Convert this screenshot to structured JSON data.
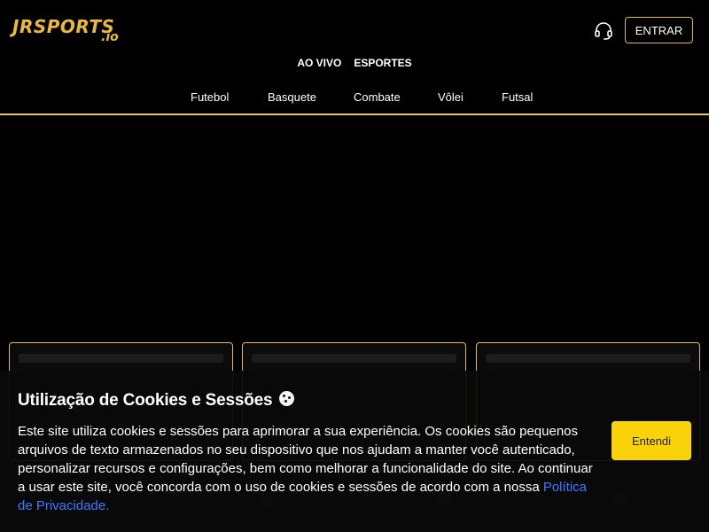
{
  "brand": {
    "logo_main": "JRSPORTS",
    "logo_sub": ".io",
    "color": "#e8b93a"
  },
  "header": {
    "support_icon": "headset-icon",
    "login_label": "ENTRAR"
  },
  "top_nav": [
    {
      "label": "AO VIVO"
    },
    {
      "label": "ESPORTES"
    }
  ],
  "sport_nav": [
    {
      "label": "Futebol"
    },
    {
      "label": "Basquete"
    },
    {
      "label": "Combate"
    },
    {
      "label": "Vôlei"
    },
    {
      "label": "Futsal"
    }
  ],
  "cookie": {
    "title": "Utilização de Cookies e Sessões",
    "title_icon": "cookie-icon",
    "text": "Este site utiliza cookies e sessões para aprimorar a sua experiência. Os cookies são pequenos arquivos de texto armazenados no seu dispositivo que nos ajudam a manter você autenticado, personalizar recursos e configurações, bem como melhorar a funcionalidade do site. Ao continuar a usar este site, você concorda com o uso de cookies e sessões de acordo com a nossa",
    "link_label": "Política de Privacidade.",
    "accept_label": "Entendi"
  },
  "colors": {
    "accent": "#e0b84a",
    "button": "#f9d20a",
    "link": "#3b7bff",
    "background": "#000000"
  }
}
